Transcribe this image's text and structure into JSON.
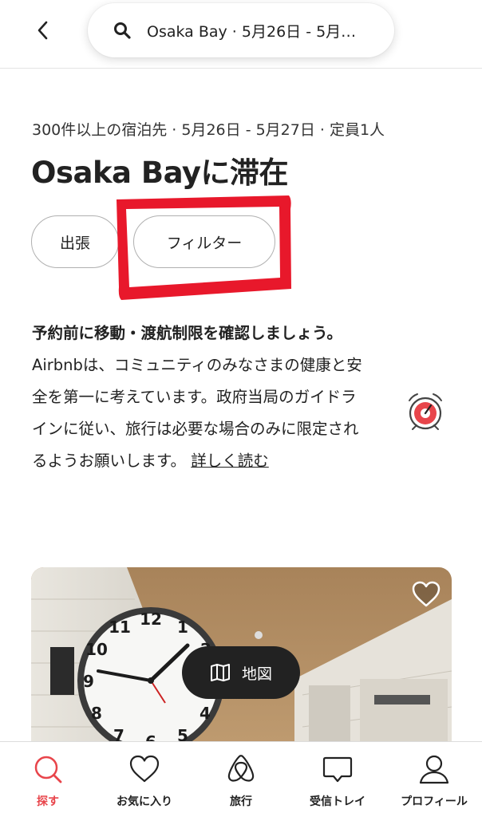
{
  "header": {
    "search_text": "Osaka Bay · 5月26日 - 5月…"
  },
  "results": {
    "subtitle": "300件以上の宿泊先 · 5月26日 - 5月27日 · 定員1人",
    "title": "Osaka Bayに滞在"
  },
  "filters": {
    "business_label": "出張",
    "filter_label": "フィルター"
  },
  "notice": {
    "bold_text": "予約前に移動・渡航制限を確認しましょう。",
    "body_text": " Airbnbは、コミュニティのみなさまの健康と安全を第一に考えています。政府当局のガイドラインに従い、旅行は必要な場合のみに限定されるようお願いします。",
    "link_text": "詳しく読む"
  },
  "map_button": {
    "label": "地図"
  },
  "tabbar": {
    "items": [
      {
        "label": "探す",
        "icon": "search-icon",
        "active": true
      },
      {
        "label": "お気に入り",
        "icon": "heart-icon"
      },
      {
        "label": "旅行",
        "icon": "airbnb-logo-icon"
      },
      {
        "label": "受信トレイ",
        "icon": "message-icon"
      },
      {
        "label": "プロフィール",
        "icon": "profile-icon"
      }
    ]
  },
  "colors": {
    "accent": "#E8454B",
    "annotation": "#E8182B",
    "text": "#222222"
  }
}
